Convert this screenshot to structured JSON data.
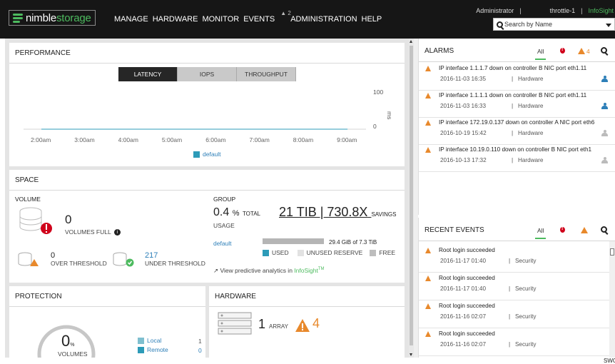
{
  "header": {
    "logo_prefix": "nimble",
    "logo_suffix": "storage",
    "nav": [
      "MANAGE",
      "HARDWARE",
      "MONITOR",
      "EVENTS",
      "ADMINISTRATION",
      "HELP"
    ],
    "events_badge": "2",
    "user": "Administrator",
    "system": "throttle-1",
    "infosight": "InfoSight",
    "search_placeholder": "Search by Name"
  },
  "performance": {
    "title": "PERFORMANCE",
    "tabs": [
      "LATENCY",
      "IOPS",
      "THROUGHPUT"
    ],
    "active_tab": "LATENCY",
    "legend": "default",
    "legend_color": "#2d9bb8"
  },
  "chart_data": {
    "type": "line",
    "x": [
      "2:00am",
      "3:00am",
      "4:00am",
      "5:00am",
      "6:00am",
      "7:00am",
      "8:00am",
      "9:00am"
    ],
    "series": [
      {
        "name": "default",
        "values": [
          0,
          0,
          0,
          0,
          0,
          0,
          0,
          0
        ]
      }
    ],
    "ylabel": "ms",
    "yticks": [
      0,
      100
    ],
    "ylim": [
      0,
      100
    ],
    "grid": false,
    "legend_position": "bottom"
  },
  "space": {
    "title": "SPACE",
    "volume_label": "VOLUME",
    "volumes_full_value": "0",
    "volumes_full_label": "VOLUMES FULL",
    "over_threshold_value": "0",
    "over_threshold_label": "OVER THRESHOLD",
    "under_threshold_value": "217",
    "under_threshold_label": "UNDER THRESHOLD",
    "group_label": "GROUP",
    "usage_pct": "0.4",
    "usage_unit": "%",
    "usage_total": "TOTAL",
    "usage_label": "USAGE",
    "capacity": "21 TIB | 730.8X",
    "savings_label": "SAVINGS",
    "pool_name": "default",
    "pool_used": "29.4 GiB of 7.3 TiB",
    "legend": [
      "USED",
      "UNUSED RESERVE",
      "FREE"
    ],
    "analytics_prefix": "View predictive analytics in ",
    "analytics_link": "InfoSight",
    "analytics_tm": "TM"
  },
  "protection": {
    "title": "PROTECTION",
    "value": "0",
    "unit": "%",
    "label": "VOLUMES",
    "items": [
      {
        "label": "Local",
        "count": "1",
        "color": "#7fbfcf"
      },
      {
        "label": "Remote",
        "count": "0",
        "color": "#2d9bb8"
      }
    ]
  },
  "hardware": {
    "title": "HARDWARE",
    "array_count": "1",
    "array_label": "ARRAY",
    "warning_count": "4"
  },
  "alarms": {
    "title": "ALARMS",
    "filter_all": "All",
    "warning_count": "4",
    "rows": [
      {
        "message": "IP interface 1.1.1.7 down on controller B NIC port eth1.11",
        "date": "2016-11-03 16:35",
        "category": "Hardware",
        "assigned": true
      },
      {
        "message": "IP interface 1.1.1.1 down on controller B NIC port eth1.11",
        "date": "2016-11-03 16:33",
        "category": "Hardware",
        "assigned": true
      },
      {
        "message": "IP interface 172.19.0.137 down on controller A NIC port eth6",
        "date": "2016-10-19 15:42",
        "category": "Hardware",
        "assigned": false
      },
      {
        "message": "IP interface 10.19.0.110 down on controller B NIC port eth1",
        "date": "2016-10-13 17:32",
        "category": "Hardware",
        "assigned": false
      }
    ]
  },
  "recent_events": {
    "title": "RECENT EVENTS",
    "filter_all": "All",
    "rows": [
      {
        "message": "Root login succeeded",
        "date": "2016-11-17 01:40",
        "category": "Security"
      },
      {
        "message": "Root login succeeded",
        "date": "2016-11-17 01:40",
        "category": "Security"
      },
      {
        "message": "Root login succeeded",
        "date": "2016-11-16 02:07",
        "category": "Security"
      },
      {
        "message": "Root login succeeded",
        "date": "2016-11-16 02:07",
        "category": "Security"
      }
    ]
  },
  "footer_tag": "SWC",
  "colors": {
    "brand_green": "#4dbb5f",
    "warning": "#e8892c",
    "critical": "#d0021b",
    "accent_blue": "#2d7fb8"
  }
}
